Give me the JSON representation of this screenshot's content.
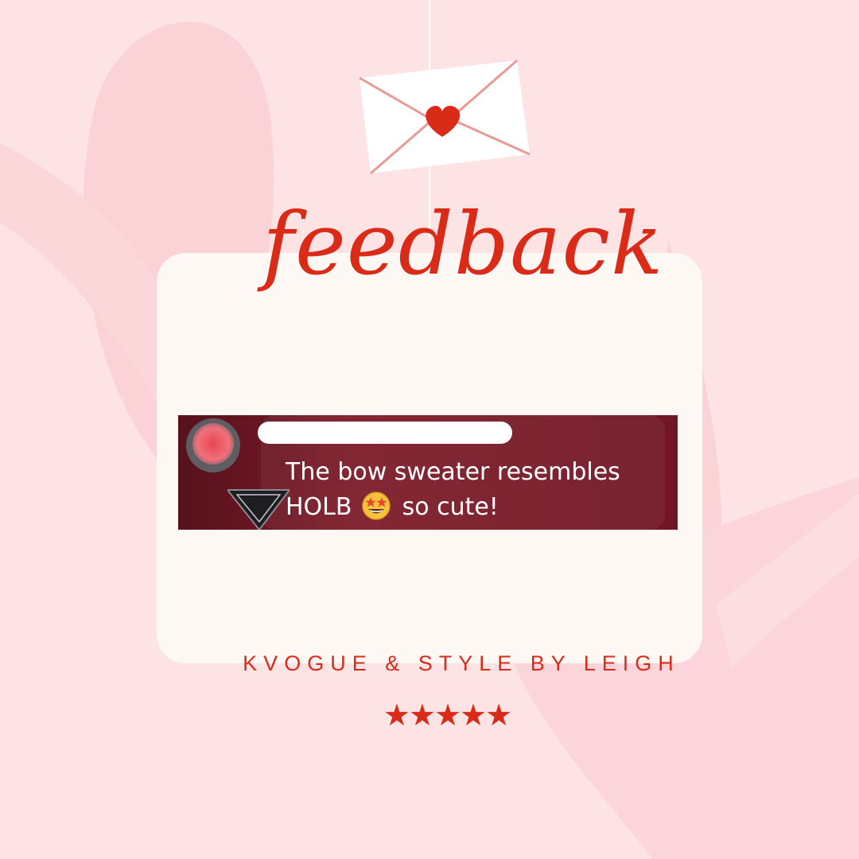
{
  "colors": {
    "background": "#fde3e4",
    "background_shape": "#fbd3d7",
    "card": "#fdf8f4",
    "accent": "#d92b18",
    "comment_bg": "#6e1623"
  },
  "title": "feedback",
  "comment": {
    "text_line1": "The bow sweater resembles",
    "text_line2_start": "HOLB",
    "emoji_icon": "star-struck-emoji",
    "text_line2_end": "so cute!"
  },
  "brand": "KVOGUE & STYLE BY LEIGH",
  "rating": {
    "stars": "★★★★★",
    "value": 5,
    "max": 5
  }
}
